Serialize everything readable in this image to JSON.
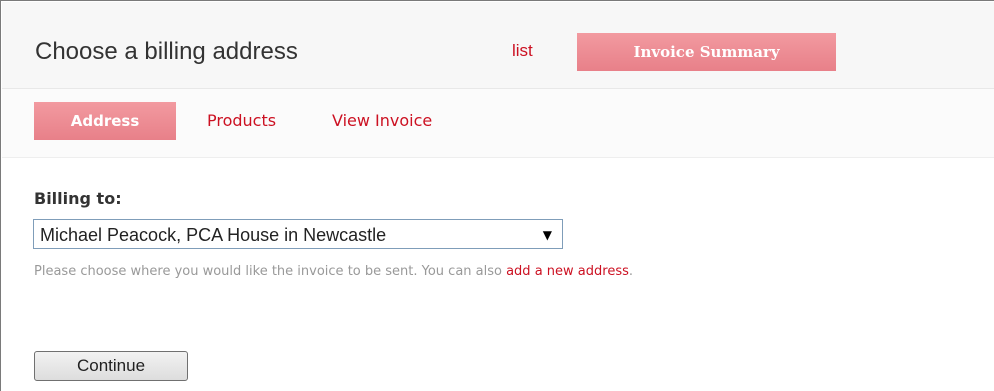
{
  "header": {
    "title": "Choose a billing address",
    "list_link": "list",
    "summary_tab": "Invoice Summary"
  },
  "subnav": {
    "active_tab": "Address",
    "tabs": [
      "Products",
      "View Invoice"
    ]
  },
  "form": {
    "billing_label": "Billing to:",
    "address_select_value": "Michael Peacock, PCA House in Newcastle",
    "help_text": "Please choose where you would like the invoice to be sent. You can also ",
    "help_link": "add a new address",
    "help_suffix": ".",
    "continue_label": "Continue"
  },
  "colors": {
    "accent": "#cc1122",
    "tab_active_bg": "#ee8a92",
    "header_bg": "#f7f7f7"
  },
  "icons": {
    "select_arrow": "chevron-down-icon"
  }
}
